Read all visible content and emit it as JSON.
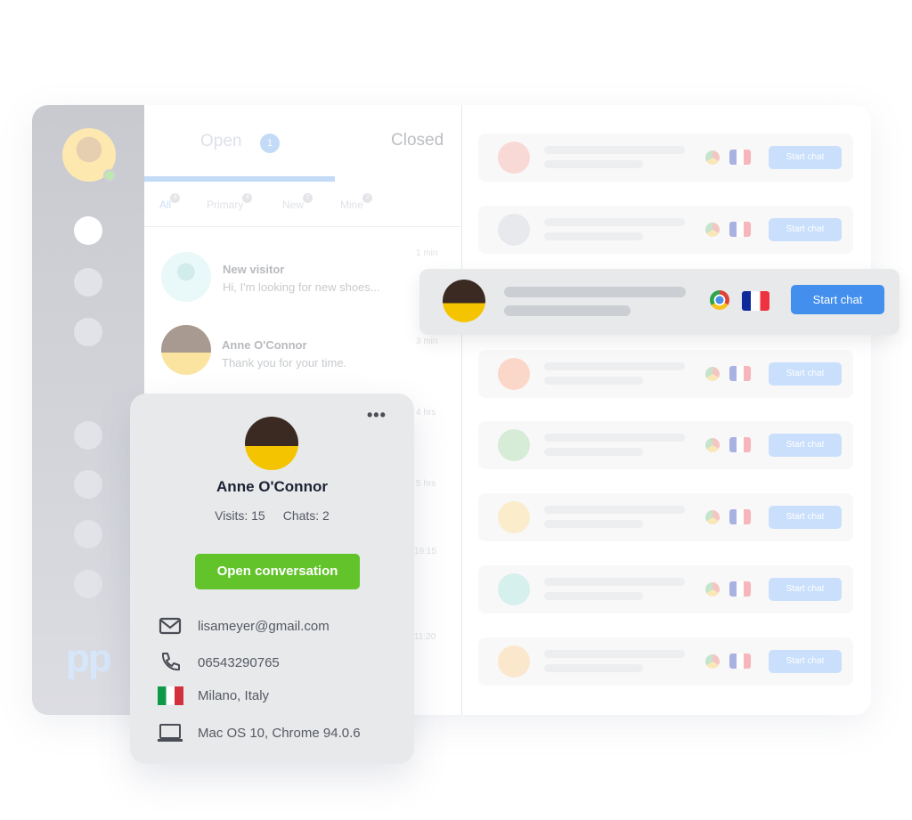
{
  "sidebar": {
    "logo": "pp",
    "nav_count": 7
  },
  "tabs": {
    "open": "Open",
    "open_count": "1",
    "closed": "Closed"
  },
  "filters": [
    {
      "label": "All",
      "count": "8"
    },
    {
      "label": "Primary",
      "count": "8"
    },
    {
      "label": "New",
      "count": "2"
    },
    {
      "label": "Mine",
      "count": "2"
    }
  ],
  "chats": [
    {
      "name": "New visitor",
      "message": "Hi, I'm looking for new shoes...",
      "time": "1 min"
    },
    {
      "name": "Anne O'Connor",
      "message": "Thank you for your time.",
      "time": "3 min"
    }
  ],
  "hidden_times": [
    "4 hrs",
    "5 hrs",
    "19:15",
    "11:20"
  ],
  "visitors": {
    "button_label": "Start chat",
    "avatar_colors": [
      "#f9d9d6",
      "#e8e9ec",
      "#fbd7c9",
      "#d6ecd6",
      "#fbeccc",
      "#d6f0ee",
      "#fbe7cc"
    ]
  },
  "highlight": {
    "button_label": "Start chat",
    "colors": {
      "button": "#438fee"
    }
  },
  "card": {
    "name": "Anne O'Connor",
    "visits": "Visits: 15",
    "chats": "Chats: 2",
    "open_button": "Open conversation",
    "email": "lisameyer@gmail.com",
    "phone": "06543290765",
    "location": "Milano, Italy",
    "device": "Mac OS 10, Chrome 94.0.6",
    "colors": {
      "open_button": "#63c32b"
    }
  }
}
